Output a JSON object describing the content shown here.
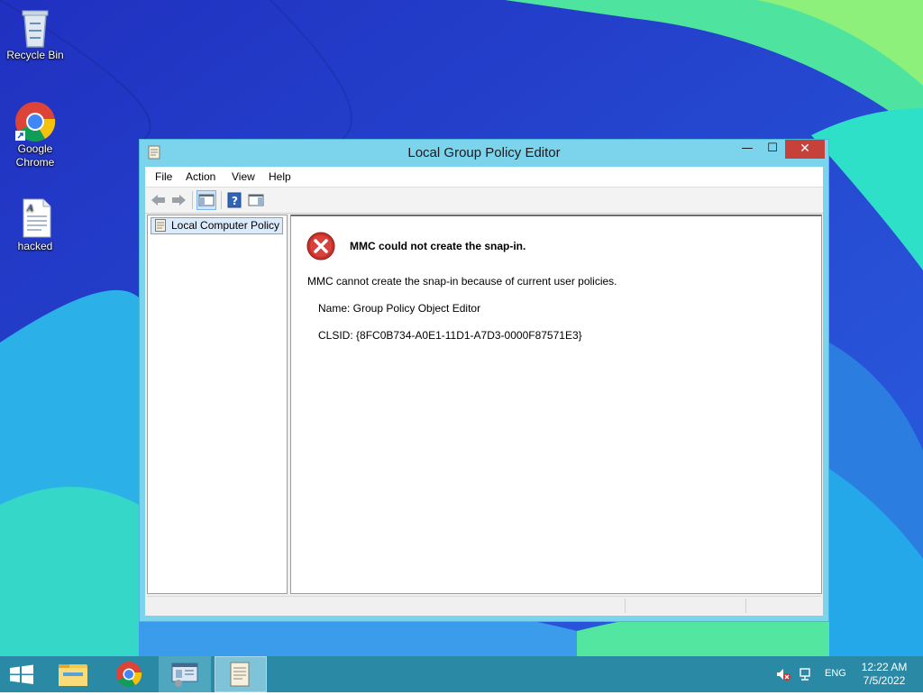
{
  "desktop": {
    "icons": [
      {
        "label": "Recycle Bin"
      },
      {
        "label": "Google\nChrome"
      },
      {
        "label": "hacked"
      }
    ]
  },
  "window": {
    "title": "Local Group Policy Editor",
    "controls": {
      "minimize": "—",
      "maximize": "☐",
      "close": "✕"
    },
    "menu": [
      "File",
      "Action",
      "View",
      "Help"
    ],
    "toolbar_icons": [
      "back-arrow-icon",
      "forward-arrow-icon",
      "show-hide-console-tree-icon",
      "help-icon",
      "show-hide-action-pane-icon"
    ],
    "tree": {
      "root_label": "Local Computer Policy"
    },
    "error": {
      "title": "MMC could not create the snap-in.",
      "message": "MMC cannot create the snap-in because of current user policies.",
      "name_line": "Name: Group Policy Object Editor",
      "clsid_line": "CLSID: {8FC0B734-A0E1-11D1-A7D3-0000F87571E3}"
    }
  },
  "taskbar": {
    "apps": [
      "start-icon",
      "file-explorer-icon",
      "chrome-icon",
      "mmc-icon",
      "group-policy-editor-icon"
    ],
    "tray": {
      "ime": "ENG",
      "time": "12:22 AM",
      "date": "7/5/2022"
    }
  },
  "colors": {
    "accent": "#7cd4ec",
    "close": "#c7413b",
    "taskbar": "#2a8aa6"
  }
}
